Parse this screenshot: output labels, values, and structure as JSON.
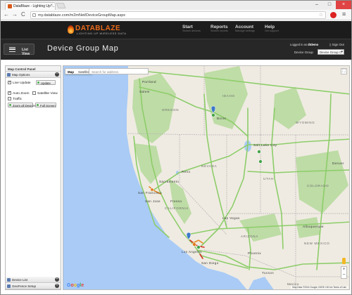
{
  "browser": {
    "tab_title": "DataBlaze - Lighting Up ...",
    "url": "my.datablaze.com/m2mNet/DeviceGroupMap.aspx",
    "nav": {
      "back": "←",
      "forward": "→",
      "reload": "C"
    }
  },
  "app": {
    "logo_text": "DATABLAZE",
    "logo_sub": "LIGHTING UP WIRELESS DATA",
    "nav": [
      {
        "title": "Start",
        "sub": "Search devices"
      },
      {
        "title": "Reports",
        "sub": "Search reports"
      },
      {
        "title": "Account",
        "sub": "Manage settings"
      },
      {
        "title": "Help",
        "sub": "Get support"
      }
    ]
  },
  "header": {
    "list_view": "List View",
    "page_title": "Device Group Map",
    "logged_in_prefix": "Logged in as",
    "username": "dtdemo",
    "sign_out": "Sign Out",
    "device_group_label": "Device Group",
    "device_group_value": "Device Group C"
  },
  "panel": {
    "title": "Map Control Panel",
    "map_options": "Map Options",
    "live_update": "Live Update",
    "update_btn": "Update",
    "auto_zoom": "Auto Zoom",
    "satellite_view": "Satellite View",
    "traffic": "Traffic",
    "zoom_all_devices": "Zoom all Devices",
    "full_screen": "Full Screen",
    "device_list": "Device List",
    "geofence_setup": "GeoFence Setup"
  },
  "map": {
    "type_map": "Map",
    "type_satellite": "Satellite",
    "search_placeholder": "Search for address",
    "attribution": "Map Data ©2016 Google, INEGI  100 km  Terms of Use",
    "labels": {
      "oregon": "OREGON",
      "idaho": "IDAHO",
      "wyoming": "WYOMING",
      "nevada": "NEVADA",
      "utah": "UTAH",
      "colorado": "COLORADO",
      "california": "CALIFORNIA",
      "arizona": "ARIZONA",
      "new_mexico": "NEW MEXICO",
      "portland": "Portland",
      "salem": "Salem",
      "boise": "Boise",
      "salt_lake_city": "Salt Lake City",
      "reno": "Reno",
      "sacramento": "Sacramento",
      "san_francisco": "San Francisco",
      "san_jose": "San Jose",
      "fresno": "Fresno",
      "las_vegas": "Las Vegas",
      "los_angeles": "Los Angeles",
      "san_diego": "San Diego",
      "phoenix": "Phoenix",
      "tucson": "Tucson",
      "albuquerque": "Albuquerque",
      "denver": "Denver",
      "mexico": "Mexico"
    }
  },
  "colors": {
    "accent_orange": "#ea6a1a",
    "header_bg": "#1c1c1c",
    "titlebar_bg": "#272727",
    "map_land": "#efebe2",
    "map_water": "#a9cbf6",
    "forest": "#b9dba0"
  }
}
